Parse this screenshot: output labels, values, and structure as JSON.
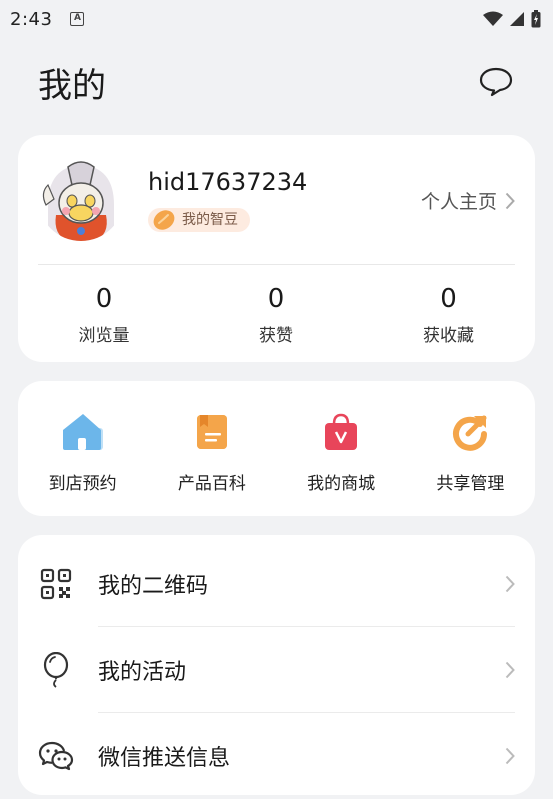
{
  "status_bar": {
    "time": "2:43",
    "a_label": "A"
  },
  "header": {
    "title": "我的"
  },
  "profile": {
    "username": "hid17637234",
    "badge_label": "我的智豆",
    "home_link": "个人主页",
    "stats": [
      {
        "value": "0",
        "label": "浏览量"
      },
      {
        "value": "0",
        "label": "获赞"
      },
      {
        "value": "0",
        "label": "获收藏"
      }
    ]
  },
  "shortcuts": [
    {
      "label": "到店预约",
      "icon": "store-home-icon"
    },
    {
      "label": "产品百科",
      "icon": "book-icon"
    },
    {
      "label": "我的商城",
      "icon": "shopping-bag-icon"
    },
    {
      "label": "共享管理",
      "icon": "share-icon"
    }
  ],
  "menu": [
    {
      "label": "我的二维码",
      "icon": "qr-code-icon"
    },
    {
      "label": "我的活动",
      "icon": "balloon-icon"
    },
    {
      "label": "微信推送信息",
      "icon": "wechat-icon"
    }
  ],
  "colors": {
    "background": "#f1f2f4",
    "card": "#ffffff",
    "accent_orange": "#f4a54a",
    "mall_red": "#e8455a",
    "store_blue": "#6cb6ea"
  }
}
